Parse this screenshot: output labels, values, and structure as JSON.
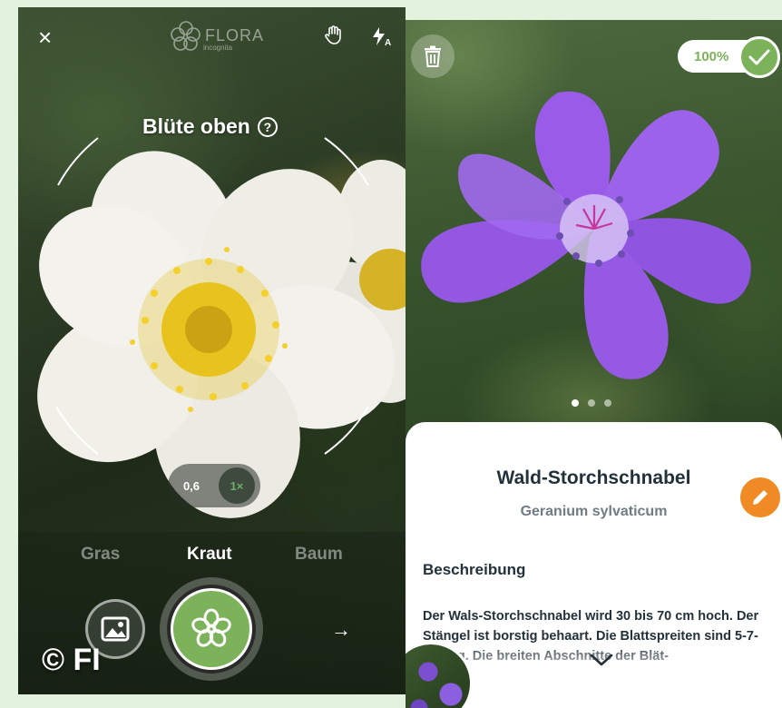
{
  "left_screen": {
    "logo": {
      "name": "FLORA",
      "subtitle": "incognita"
    },
    "hint": {
      "title": "Blüte oben",
      "help": "?"
    },
    "zoom": {
      "option_1": "0,6",
      "option_2": "1×"
    },
    "mode_tabs": [
      {
        "label": "Gras",
        "active": false
      },
      {
        "label": "Kraut",
        "active": true
      },
      {
        "label": "Baum",
        "active": false
      }
    ],
    "next_arrow": "→",
    "close": "×",
    "watermark": "© FI"
  },
  "right_screen": {
    "confidence": "100%",
    "carousel": {
      "count": 3,
      "active_index": 0
    },
    "plant": {
      "name": "Wald-Storchschnabel",
      "latin_name": "Geranium sylvaticum"
    },
    "section_title": "Beschreibung",
    "description": "Der Wals-Storchschnabel wird 30 bis 70 cm hoch. Der Stängel ist borstig behaart. Die Blattspreiten sind 5-7-spaltig. Die breiten Abschnitte der Blät-"
  },
  "colors": {
    "accent_green": "#7cb35a",
    "edit_orange": "#f08a24",
    "text_dark": "#22313a",
    "text_muted": "#6f7c84",
    "page_background": "#e3f2df"
  },
  "icons": [
    "close-icon",
    "hand-icon",
    "flash-auto-icon",
    "help-icon",
    "gallery-icon",
    "flower-shutter-icon",
    "arrow-right-icon",
    "trash-icon",
    "check-icon",
    "edit-pencil-icon",
    "chevron-down-icon"
  ]
}
